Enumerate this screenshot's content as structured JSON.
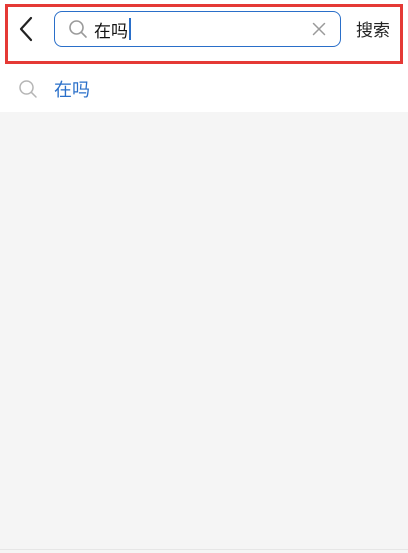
{
  "header": {
    "back_icon": "chevron-left-icon",
    "search": {
      "icon": "search-icon",
      "value": "在吗",
      "clear_icon": "close-icon"
    },
    "search_button_label": "搜索"
  },
  "suggestions": [
    {
      "icon": "search-icon",
      "label": "在吗"
    }
  ],
  "colors": {
    "accent": "#2a6fc9",
    "highlight": "#e53935",
    "background": "#f5f5f5"
  }
}
